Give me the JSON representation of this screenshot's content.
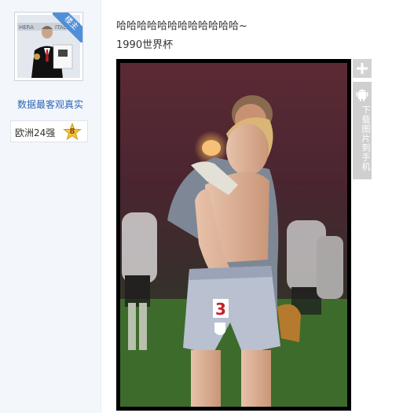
{
  "author": {
    "badge": "楼主",
    "name": "数据最客观真实",
    "rank_label": "欧洲24强",
    "rank_level": "8",
    "avatar_text": "HERA… ITAL M"
  },
  "post": {
    "title": "哈哈哈哈哈哈哈哈哈哈哈哈~",
    "subtitle": "1990世界杯"
  },
  "image_tools": {
    "zoom_icon": "plus-icon",
    "download_label": "下载图片到手机",
    "download_icon": "android-icon"
  },
  "photo": {
    "shirt_number": "3"
  },
  "colors": {
    "link": "#2d64b3",
    "badge": "#4f8fd8",
    "sidebar_bg": "#f3f7fc",
    "tool_bg": "#d2d2d2"
  }
}
